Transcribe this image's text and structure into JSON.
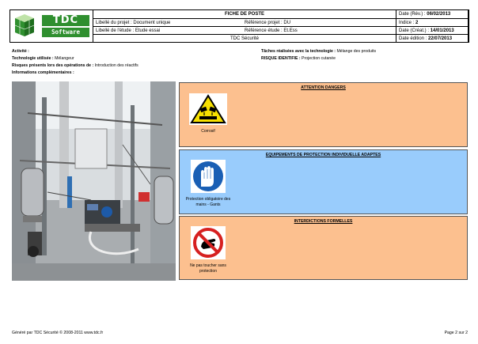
{
  "header": {
    "title": "FICHE DE POSTE",
    "logo_text_1": "TDC",
    "logo_text_2": "Software",
    "libelle_projet": "Libellé du projet : Document unique",
    "reference_projet": "Référence projet : DU",
    "libelle_etude": "Libellé de l'étude : Etude essai",
    "reference_etude": "Référence étude : Et.Ess",
    "subtitle": "TDC Sécurité",
    "date_rev_label": "Date (Rév.) :",
    "date_rev_value": "06/02/2013",
    "indice_label": "Indice :",
    "indice_value": "2",
    "date_creat_label": "Date (Créat.) :",
    "date_creat_value": "14/01/2013",
    "date_edition_label": "Date édition :",
    "date_edition_value": "22/07/2013"
  },
  "info": {
    "activite_label": "Activité :",
    "techno_label": "Technologie utilisée :",
    "techno_value": " Mélangeur",
    "risques_label": "Risques présents lors des opérations de :",
    "risques_value": " Introduction des réactifs",
    "infos_label": "Informations complémentaires :",
    "taches_label": "Tâches réalisées avec la technologie :",
    "taches_value": " Mélange des produits",
    "risque_ident_label": "RISQUE IDENTIFIE :",
    "risque_ident_value": " Projection cutanée"
  },
  "panels": {
    "dangers": {
      "title": "ATTENTION DANGERS",
      "item_caption": "Corrosif",
      "color": "#fcc08f"
    },
    "epi": {
      "title": "EQUIPEMENTS DE PROTECTION INDIVIDUELLE ADAPTES",
      "item_caption": "Protection obligatoire des mains - Gants",
      "color": "#99ccfc"
    },
    "interdictions": {
      "title": "INTERDICTIONS FORMELLES",
      "item_caption": "Ne pas toucher sans protection",
      "color": "#fcc08f"
    }
  },
  "footer": {
    "left": "Généré par TDC Sécurité © 2008-2011  www.tdc.fr",
    "right": "Page 2 sur 2"
  }
}
